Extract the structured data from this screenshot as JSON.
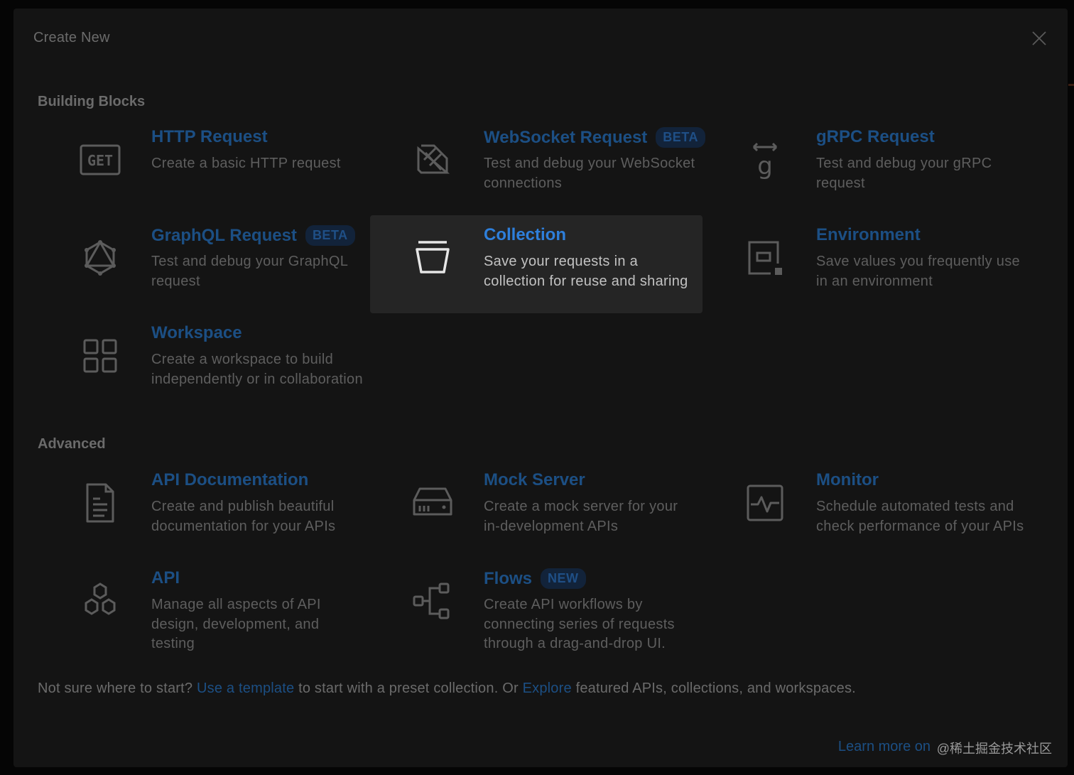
{
  "modal": {
    "title": "Create New",
    "close_icon": "close-icon"
  },
  "sections": {
    "building_blocks": "Building Blocks",
    "advanced": "Advanced"
  },
  "cards": {
    "http": {
      "icon": "get-icon",
      "title": "HTTP Request",
      "desc": "Create a basic HTTP request"
    },
    "websocket": {
      "icon": "websocket-icon",
      "title": "WebSocket Request",
      "badge": "BETA",
      "desc": "Test and debug your WebSocket connections"
    },
    "grpc": {
      "icon": "grpc-icon",
      "title": "gRPC Request",
      "desc": "Test and debug your gRPC request"
    },
    "graphql": {
      "icon": "graphql-icon",
      "title": "GraphQL Request",
      "badge": "BETA",
      "desc": "Test and debug your GraphQL request"
    },
    "collection": {
      "icon": "collection-icon",
      "title": "Collection",
      "desc": "Save your requests in a collection for reuse and sharing"
    },
    "environment": {
      "icon": "environment-icon",
      "title": "Environment",
      "desc": "Save values you frequently use in an environment"
    },
    "workspace": {
      "icon": "workspace-icon",
      "title": "Workspace",
      "desc": "Create a workspace to build independently or in collaboration"
    },
    "api_docs": {
      "icon": "document-icon",
      "title": "API Documentation",
      "desc": "Create and publish beautiful documentation for your APIs"
    },
    "mock_server": {
      "icon": "server-icon",
      "title": "Mock Server",
      "desc": "Create a mock server for your in-development APIs"
    },
    "monitor": {
      "icon": "monitor-icon",
      "title": "Monitor",
      "desc": "Schedule automated tests and check performance of your APIs"
    },
    "api": {
      "icon": "api-icon",
      "title": "API",
      "desc": "Manage all aspects of API design, development, and testing"
    },
    "flows": {
      "icon": "flows-icon",
      "title": "Flows",
      "badge": "NEW",
      "desc": "Create API workflows by connecting series of requests through a drag-and-drop UI."
    }
  },
  "footer": {
    "prefix": "Not sure where to start?",
    "template_link": "Use a template",
    "middle": "to start with a preset collection. Or",
    "explore_link": "Explore",
    "suffix": "featured APIs, collections, and workspaces."
  },
  "learn_more": "Learn more on",
  "watermark": "@稀土掘金技术社区",
  "colors": {
    "background": "#141414",
    "active_card": "#252525",
    "title_dim": "#1c4f84",
    "title_active": "#2e7fdb",
    "badge_bg": "#12233a"
  }
}
